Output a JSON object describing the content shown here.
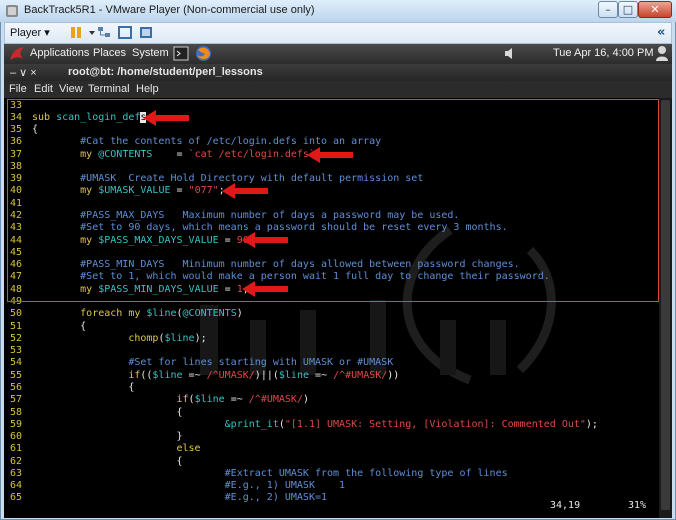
{
  "window": {
    "title": "BackTrack5R1 - VMware Player (Non-commercial use only)",
    "min_glyph": "–",
    "max_glyph": "□",
    "close_glyph": "✕"
  },
  "toolbar": {
    "player_menu": "Player ▾",
    "collapse_glyph": "«"
  },
  "gnome_panel": {
    "applications": "Applications",
    "places": "Places",
    "system": "System",
    "datetime": "Tue Apr 16,  4:00 PM"
  },
  "terminal": {
    "title": "root@bt: /home/student/perl_lessons",
    "controls": "–  ∨  ×",
    "menu": [
      "File",
      "Edit",
      "View",
      "Terminal",
      "Help"
    ]
  },
  "editor": {
    "lines": [
      {
        "n": "33",
        "segs": []
      },
      {
        "n": "34",
        "segs": [
          {
            "c": "kw",
            "t": "sub "
          },
          {
            "c": "fn",
            "t": "scan_login_def"
          },
          {
            "c": "cur",
            "t": "s"
          }
        ]
      },
      {
        "n": "35",
        "segs": [
          {
            "c": "txt",
            "t": "{"
          }
        ]
      },
      {
        "n": "36",
        "segs": [
          {
            "c": "cm",
            "t": "        #Cat the contents of /etc/login.defs into an array"
          }
        ]
      },
      {
        "n": "37",
        "segs": [
          {
            "c": "kw",
            "t": "        my "
          },
          {
            "c": "var",
            "t": "@CONTENTS"
          },
          {
            "c": "txt",
            "t": "    = "
          },
          {
            "c": "str",
            "t": "`cat /etc/login.defs`"
          },
          {
            "c": "txt",
            "t": ";"
          }
        ]
      },
      {
        "n": "38",
        "segs": []
      },
      {
        "n": "39",
        "segs": [
          {
            "c": "cm",
            "t": "        #UMASK  Create Hold Directory with default permission set"
          }
        ]
      },
      {
        "n": "40",
        "segs": [
          {
            "c": "kw",
            "t": "        my "
          },
          {
            "c": "var",
            "t": "$UMASK_VALUE"
          },
          {
            "c": "txt",
            "t": " = "
          },
          {
            "c": "str",
            "t": "\"077\""
          },
          {
            "c": "txt",
            "t": ";"
          }
        ]
      },
      {
        "n": "41",
        "segs": []
      },
      {
        "n": "42",
        "segs": [
          {
            "c": "cm",
            "t": "        #PASS_MAX_DAYS   Maximum number of days a password may be used."
          }
        ]
      },
      {
        "n": "43",
        "segs": [
          {
            "c": "cm",
            "t": "        #Set to 90 days, which means a password should be reset every 3 months."
          }
        ]
      },
      {
        "n": "44",
        "segs": [
          {
            "c": "kw",
            "t": "        my "
          },
          {
            "c": "var",
            "t": "$PASS_MAX_DAYS_VALUE"
          },
          {
            "c": "txt",
            "t": " = "
          },
          {
            "c": "str",
            "t": "90"
          },
          {
            "c": "txt",
            "t": ";"
          }
        ]
      },
      {
        "n": "45",
        "segs": []
      },
      {
        "n": "46",
        "segs": [
          {
            "c": "cm",
            "t": "        #PASS_MIN_DAYS   Minimum number of days allowed between password changes."
          }
        ]
      },
      {
        "n": "47",
        "segs": [
          {
            "c": "cm",
            "t": "        #Set to 1, which would make a person wait 1 full day to change their password."
          }
        ]
      },
      {
        "n": "48",
        "segs": [
          {
            "c": "kw",
            "t": "        my "
          },
          {
            "c": "var",
            "t": "$PASS_MIN_DAYS_VALUE"
          },
          {
            "c": "txt",
            "t": " = "
          },
          {
            "c": "str",
            "t": "1"
          },
          {
            "c": "txt",
            "t": ";"
          }
        ]
      },
      {
        "n": "49",
        "segs": []
      },
      {
        "n": "50",
        "segs": [
          {
            "c": "kw",
            "t": "        foreach my "
          },
          {
            "c": "var",
            "t": "$line"
          },
          {
            "c": "txt",
            "t": "("
          },
          {
            "c": "var",
            "t": "@CONTENTS"
          },
          {
            "c": "txt",
            "t": ")"
          }
        ]
      },
      {
        "n": "51",
        "segs": [
          {
            "c": "txt",
            "t": "        {"
          }
        ]
      },
      {
        "n": "52",
        "segs": [
          {
            "c": "kw",
            "t": "                chomp"
          },
          {
            "c": "txt",
            "t": "("
          },
          {
            "c": "var",
            "t": "$line"
          },
          {
            "c": "txt",
            "t": ");"
          }
        ]
      },
      {
        "n": "53",
        "segs": []
      },
      {
        "n": "54",
        "segs": [
          {
            "c": "cm",
            "t": "                #Set for lines starting with UMASK or #UMASK"
          }
        ]
      },
      {
        "n": "55",
        "segs": [
          {
            "c": "kw",
            "t": "                if"
          },
          {
            "c": "txt",
            "t": "(("
          },
          {
            "c": "var",
            "t": "$line"
          },
          {
            "c": "txt",
            "t": " =~ "
          },
          {
            "c": "str",
            "t": "/^UMASK/"
          },
          {
            "c": "txt",
            "t": ")||("
          },
          {
            "c": "var",
            "t": "$line"
          },
          {
            "c": "txt",
            "t": " =~ "
          },
          {
            "c": "str",
            "t": "/^#UMASK/"
          },
          {
            "c": "txt",
            "t": "))"
          }
        ]
      },
      {
        "n": "56",
        "segs": [
          {
            "c": "txt",
            "t": "                {"
          }
        ]
      },
      {
        "n": "57",
        "segs": [
          {
            "c": "kw",
            "t": "                        if"
          },
          {
            "c": "txt",
            "t": "("
          },
          {
            "c": "var",
            "t": "$line"
          },
          {
            "c": "txt",
            "t": " =~ "
          },
          {
            "c": "str",
            "t": "/^#UMASK/"
          },
          {
            "c": "txt",
            "t": ")"
          }
        ]
      },
      {
        "n": "58",
        "segs": [
          {
            "c": "txt",
            "t": "                        {"
          }
        ]
      },
      {
        "n": "59",
        "segs": [
          {
            "c": "txt",
            "t": "                                "
          },
          {
            "c": "fn",
            "t": "&print_it"
          },
          {
            "c": "txt",
            "t": "("
          },
          {
            "c": "str",
            "t": "\"[1.1] UMASK: Setting, [Violation]: Commented Out\""
          },
          {
            "c": "txt",
            "t": ");"
          }
        ]
      },
      {
        "n": "60",
        "segs": [
          {
            "c": "txt",
            "t": "                        }"
          }
        ]
      },
      {
        "n": "61",
        "segs": [
          {
            "c": "kw",
            "t": "                        else"
          }
        ]
      },
      {
        "n": "62",
        "segs": [
          {
            "c": "txt",
            "t": "                        {"
          }
        ]
      },
      {
        "n": "63",
        "segs": [
          {
            "c": "cm",
            "t": "                                #Extract UMASK from the following type of lines"
          }
        ]
      },
      {
        "n": "64",
        "segs": [
          {
            "c": "cm",
            "t": "                                #E.g., 1) UMASK    1"
          }
        ]
      },
      {
        "n": "65",
        "segs": [
          {
            "c": "cm",
            "t": "                                #E.g., 2) UMASK=1"
          }
        ]
      }
    ],
    "status_position": "34,19",
    "status_percent": "31%"
  },
  "colors": {
    "highlight": "#d9453f",
    "arrow": "#e01818"
  }
}
